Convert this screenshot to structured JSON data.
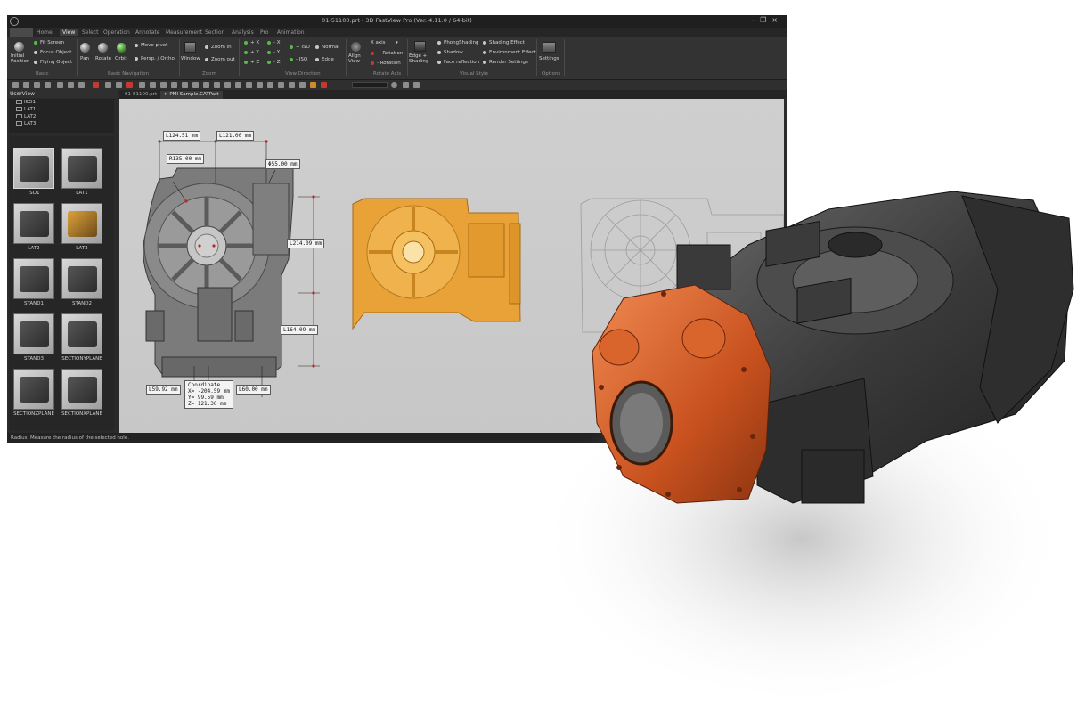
{
  "window": {
    "title": "01-51100.prt - 3D FastView Pro (Ver. 4.11.0 / 64-bit)",
    "controls": [
      "–",
      "❐",
      "×"
    ]
  },
  "menu": {
    "tabs": [
      "Home",
      "View",
      "Select",
      "Operation",
      "Annotate",
      "Measurement",
      "Section",
      "Analysis",
      "Pro",
      "Animation"
    ],
    "active_tab": "View"
  },
  "ribbon": {
    "groups": {
      "basic": "Basic",
      "basic_navigation": "Basic Navigation",
      "zoom": "Zoom",
      "view_direction": "View Direction",
      "rotate_axis": "Rotate Axis",
      "visual_style": "Visual Style",
      "options": "Options"
    },
    "items": {
      "initial_position": "Initial\nPosition",
      "fit_screen": "Fit Screen",
      "focus_object": "Focus Object",
      "flying_object": "Flying Object",
      "pan": "Pan",
      "rotate": "Rotate",
      "orbit": "Orbit",
      "move_pivot": "Move pivot",
      "persp_ortho": "Persp. / Ortho.",
      "window": "Window",
      "zoom_in": "Zoom in",
      "zoom_out": "Zoom out",
      "plus_x": "+ X",
      "plus_y": "+ Y",
      "plus_z": "+ Z",
      "minus_x": "- X",
      "minus_y": "- Y",
      "minus_z": "- Z",
      "plus_iso": "+ ISO",
      "minus_iso": "- ISO",
      "normal": "Normal",
      "edge": "Edge",
      "align_view": "Align\nView",
      "x_axis": "X axis",
      "plus_rotation": "+ Rotation",
      "minus_rotation": "- Rotation",
      "edge_shading": "Edge +\nShading",
      "phong_shading": "PhongShading",
      "shadow": "Shadow",
      "face_reflection": "Face reflection",
      "shading_effect": "Shading Effect",
      "environment_effect": "Environment Effect",
      "render_settings": "Render Settings",
      "settings": "Settings"
    }
  },
  "panel": {
    "title": "UserView",
    "views": [
      "ISO1",
      "LAT1",
      "LAT2",
      "LAT3"
    ],
    "thumbnails": [
      "ISO1",
      "LAT1",
      "LAT2",
      "LAT3",
      "STAND1",
      "STAND2",
      "STAND3",
      "SECTIONYPLANE",
      "SECTIONZPLANE",
      "SECTIONXPLANE"
    ]
  },
  "doc_tabs": [
    "01-51100.prt",
    "PMI Sample.CATPart"
  ],
  "dimensions": {
    "l1": "L124.51 mm",
    "l2": "L121.00 mm",
    "r1": "R135.00 mm",
    "phi": "Φ55.00 mm",
    "l3": "L214.09 mm",
    "l4": "L164.09 mm",
    "l5": "L59.92 mm",
    "l6": "L60.00 mm"
  },
  "coordinate": {
    "title": "Coordinate",
    "x": "X= -204.59 mm",
    "y": "Y= 99.59 mm",
    "z": "Z= 121.30 mm"
  },
  "status": {
    "label": "Radius",
    "message": "Measure the radius of the selected hole."
  },
  "colors": {
    "accent_orange": "#e8a238",
    "render_orange": "#d9602a",
    "window_bg": "#2b2b2b"
  }
}
